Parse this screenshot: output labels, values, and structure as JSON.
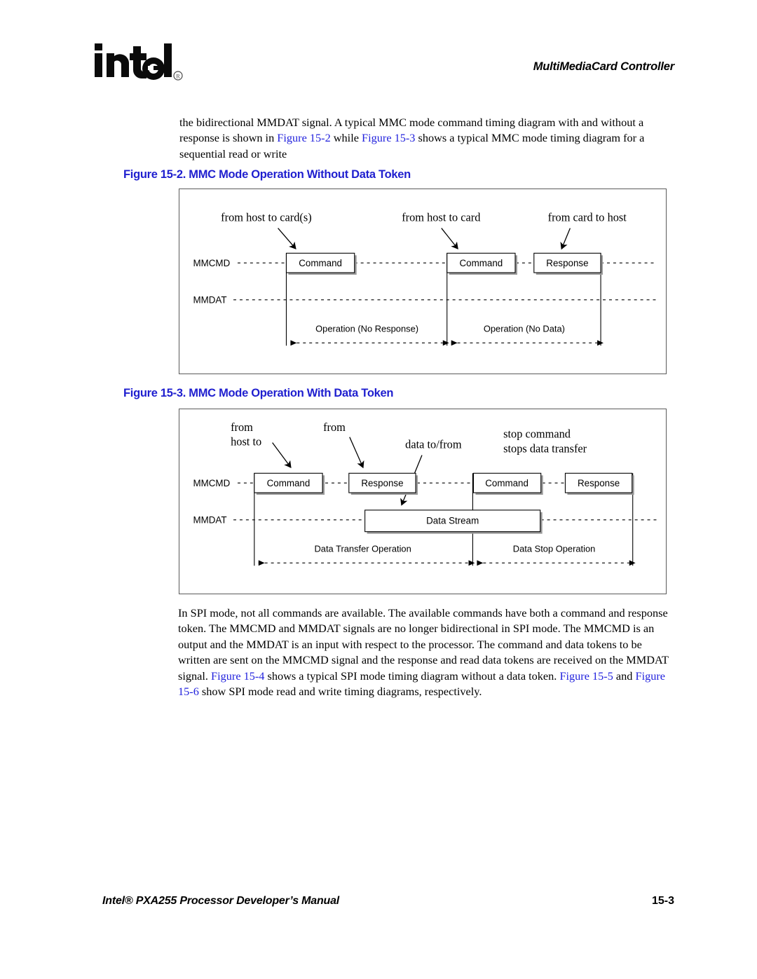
{
  "header": {
    "logo_text": "intel",
    "logo_registered_mark": "®",
    "chapter_title": "MultiMediaCard Controller"
  },
  "intro_paragraph": {
    "part1": "the bidirectional MMDAT signal. A typical MMC mode command timing diagram with and without a response is shown in ",
    "xref1": "Figure 15-2",
    "part2": " while ",
    "xref2": "Figure 15-3",
    "part3": " shows a typical MMC mode timing diagram for a sequential read or write"
  },
  "figure_2": {
    "caption": "Figure 15-2. MMC Mode Operation Without Data Token",
    "annotations": [
      "from host to card(s)",
      "from host to card",
      "from card to host"
    ],
    "signals": [
      "MMCMD",
      "MMDAT"
    ],
    "tokens": [
      "Command",
      "Command",
      "Response"
    ],
    "operations": [
      "Operation (No Response)",
      "Operation (No Data)"
    ]
  },
  "figure_3": {
    "caption": "Figure 15-3. MMC Mode Operation With Data Token",
    "annotations": {
      "a1_line1": "from",
      "a1_line2": "host to",
      "a2_line1": "from",
      "a3_line1": "data to/from",
      "a4_line1": "stop command",
      "a4_line2": "stops data transfer"
    },
    "signals": [
      "MMCMD",
      "MMDAT"
    ],
    "tokens": [
      "Command",
      "Response",
      "Command",
      "Response"
    ],
    "data_token": "Data Stream",
    "operations": [
      "Data Transfer Operation",
      "Data Stop Operation"
    ]
  },
  "spi_paragraph": {
    "part1": "In SPI mode, not all commands are available. The available commands have both a command and response token. The MMCMD and MMDAT signals are no longer bidirectional in SPI mode. The MMCMD is an output and the MMDAT is an input with respect to the processor. The command and data tokens to be written are sent on the MMCMD signal and the response and read data tokens are received on the MMDAT signal. ",
    "xref1": "Figure 15-4",
    "part2": " shows a typical SPI mode timing diagram without a data token. ",
    "xref2": "Figure 15-5",
    "part3": " and ",
    "xref3": "Figure 15-6",
    "part4": " show SPI mode read and write timing diagrams, respectively."
  },
  "footer": {
    "manual_title": "Intel® PXA255 Processor Developer’s Manual",
    "page_number": "15-3"
  },
  "colors": {
    "xref_blue": "#2222dd",
    "caption_blue": "#1f1fcf",
    "frame_gray": "#5a5a5a",
    "shadow_gray": "#9a9a9a"
  }
}
